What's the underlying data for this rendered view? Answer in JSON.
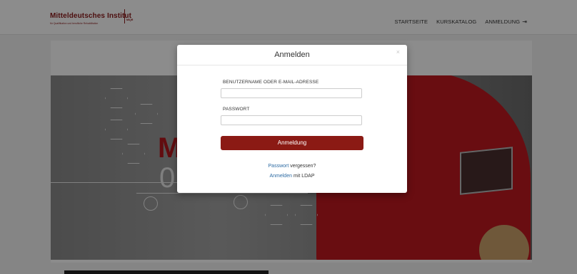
{
  "logo": {
    "name": "Mitteldeutsches Institut",
    "tagline": "für Qualifikation und berufliche Rehabilitation",
    "abbr": "MIQR"
  },
  "nav": {
    "items": [
      {
        "label": "STARTSEITE"
      },
      {
        "label": "KURSKATALOG"
      },
      {
        "label": "ANMELDUNG"
      }
    ],
    "login_icon": "sign-in-icon"
  },
  "hero": {
    "letter_1": "M",
    "letter_2": "0"
  },
  "modal": {
    "title": "Anmelden",
    "close_icon": "close-icon",
    "username_label": "BENUTZERNAME ODER E-MAIL-ADRESSE",
    "username_value": "",
    "password_label": "PASSWORT",
    "password_value": "",
    "submit_label": "Anmeldung",
    "forgot_link": "Passwort",
    "forgot_text": "vergessen?",
    "ldap_link": "Anmelden",
    "ldap_text": "mit LDAP"
  },
  "colors": {
    "brand": "#8b1a1a",
    "button": "#8b1a14",
    "link": "#2d6ba3"
  }
}
